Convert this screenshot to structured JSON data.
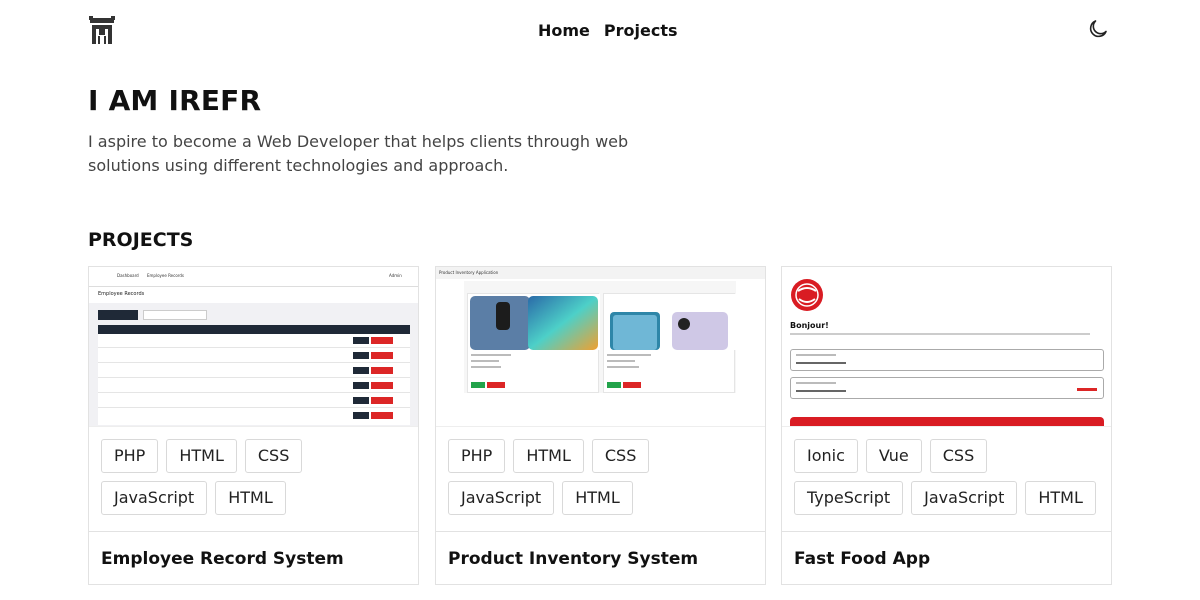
{
  "nav": {
    "links": [
      "Home",
      "Projects"
    ],
    "logo_icon": "building-logo-icon",
    "theme_icon": "moon-icon"
  },
  "hero": {
    "title": "I AM IREFR",
    "description": "I aspire to become a Web Developer that helps clients through web solutions using different technologies and approach."
  },
  "projects": {
    "heading": "PROJECTS",
    "cards": [
      {
        "title": "Employee Record System",
        "tags": [
          "PHP",
          "HTML",
          "CSS",
          "JavaScript",
          "HTML"
        ],
        "thumb": {
          "nav_items": [
            "Dashboard",
            "Employee Records",
            "Admin"
          ],
          "heading": "Employee Records",
          "button": "CREATE EMPLOYEE"
        }
      },
      {
        "title": "Product Inventory System",
        "tags": [
          "PHP",
          "HTML",
          "CSS",
          "JavaScript",
          "HTML"
        ],
        "thumb": {
          "app_title": "Product Inventory Application",
          "create_label": "Create Product"
        }
      },
      {
        "title": "Fast Food App",
        "tags": [
          "Ionic",
          "Vue",
          "CSS",
          "TypeScript",
          "JavaScript",
          "HTML"
        ],
        "thumb": {
          "greeting": "Bonjour!",
          "email_placeholder": "Enter your email",
          "password_placeholder": "Enter your password",
          "forgot": "Forgot?"
        }
      }
    ]
  },
  "colors": {
    "text": "#111111",
    "muted": "#444444",
    "border": "#e2e2e2",
    "accent_red": "#d91c23",
    "dark": "#1f2937"
  }
}
